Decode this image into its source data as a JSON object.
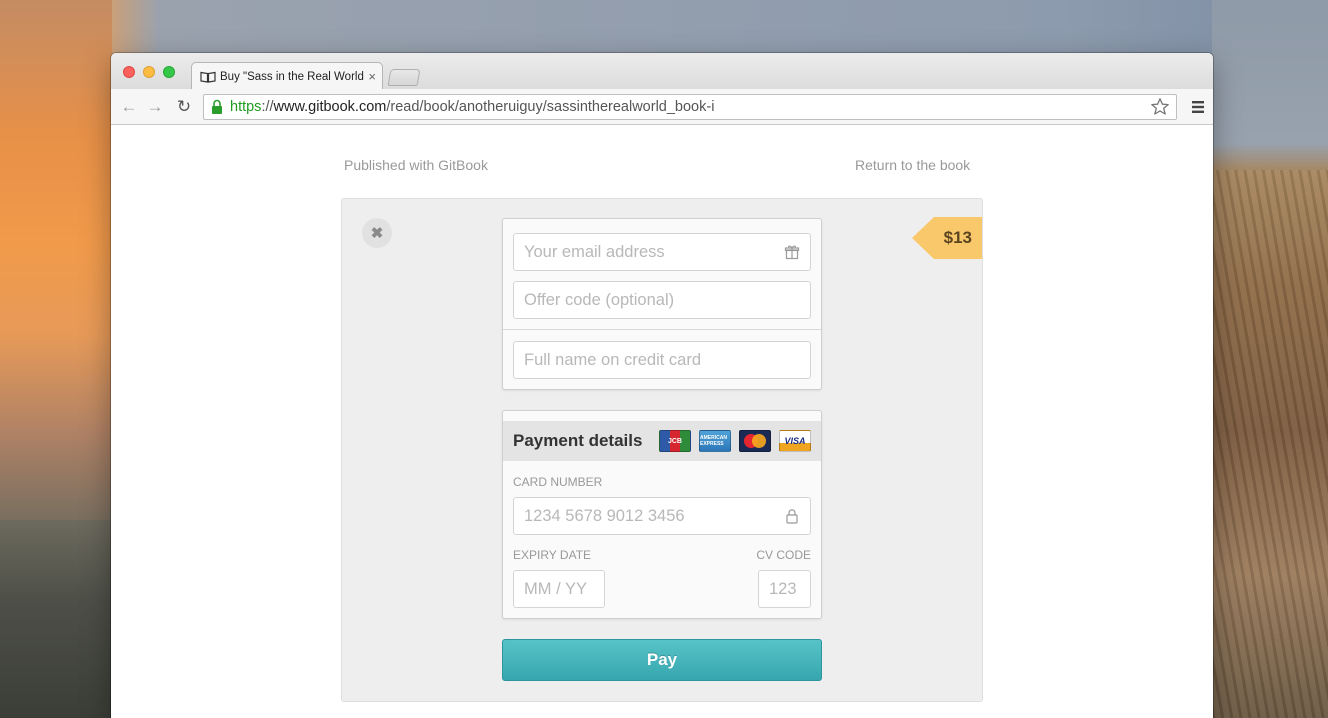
{
  "browser": {
    "tab_title": "Buy \"Sass in the Real World",
    "tab_close": "×",
    "url": {
      "scheme": "https",
      "separator": "://",
      "domain": "www.gitbook.com",
      "path": "/read/book/anotheruiguy/sassintherealworld_book-i"
    },
    "nav": {
      "back": "←",
      "forward": "→",
      "reload": "↻"
    }
  },
  "page": {
    "published": "Published with GitBook",
    "return_link": "Return to the book",
    "close_symbol": "✖",
    "price": "$13",
    "form": {
      "email_placeholder": "Your email address",
      "offer_placeholder": "Offer code (optional)",
      "name_placeholder": "Full name on credit card"
    },
    "payment": {
      "title": "Payment details",
      "card_brands": [
        "JCB",
        "AMERICAN EXPRESS",
        "MasterCard",
        "VISA"
      ],
      "card_number_label": "CARD NUMBER",
      "card_number_placeholder": "1234 5678 9012 3456",
      "expiry_label": "EXPIRY DATE",
      "expiry_placeholder": "MM / YY",
      "cv_label": "CV CODE",
      "cv_placeholder": "123"
    },
    "pay_button": "Pay"
  }
}
